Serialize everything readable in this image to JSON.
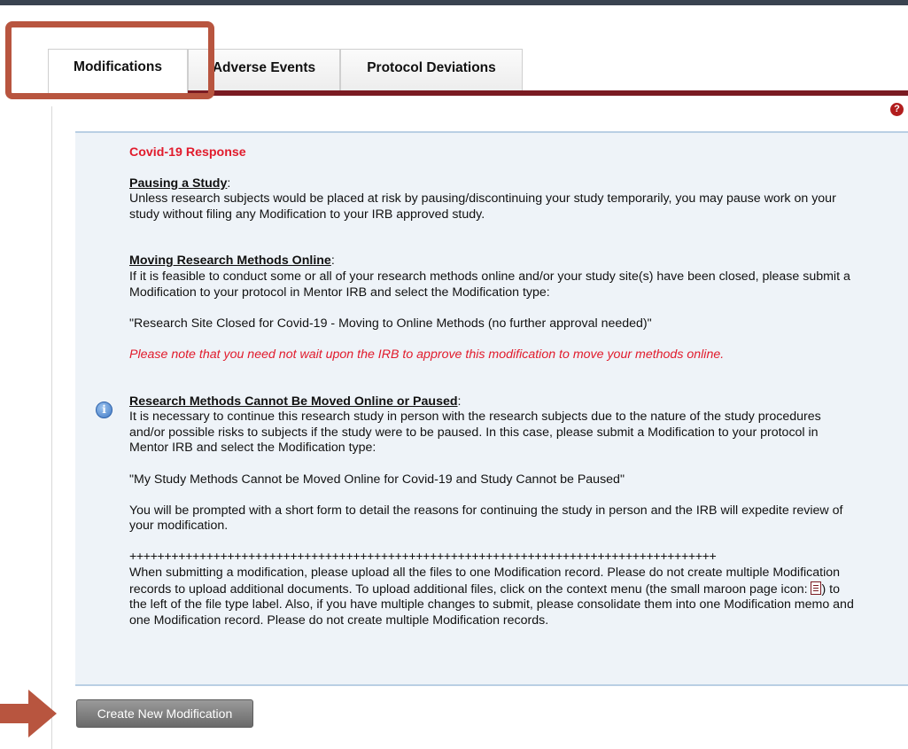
{
  "tabs": [
    {
      "label": "Modifications",
      "active": true
    },
    {
      "label": "Adverse Events",
      "active": false
    },
    {
      "label": "Protocol Deviations",
      "active": false
    }
  ],
  "help_icon": "?",
  "info_icon": "i",
  "notice": {
    "title": "Covid-19 Response",
    "pausing_heading": "Pausing a Study",
    "pausing_text": "Unless research subjects would be placed at risk by pausing/discontinuing your study temporarily, you may pause work on your study without filing any Modification to your IRB approved study.",
    "moving_heading": "Moving Research Methods Online",
    "moving_text": "If it is feasible to conduct some or all of your research methods online and/or your study site(s) have been closed, please submit a Modification to your protocol in Mentor IRB and select the Modification type:",
    "moving_type": "\"Research Site Closed for Covid-19 - Moving to Online Methods (no further approval needed)\"",
    "moving_note": "Please note that you need not wait upon the IRB to approve this modification to move your methods online.",
    "cannot_heading": "Research Methods Cannot Be Moved Online or Paused",
    "cannot_text": "It is necessary to continue this research study in person with the research subjects due to the nature of the study procedures and/or possible risks to subjects if the study were to be paused. In this case, please submit a Modification to your protocol in Mentor IRB and select the Modification type:",
    "cannot_type": "\"My Study Methods Cannot be Moved Online for Covid-19 and Study Cannot be Paused\"",
    "prompted_text": "You will be prompted with a short form to detail the reasons for continuing the study in person and the IRB will expedite review of your modification.",
    "separator": "++++++++++++++++++++++++++++++++++++++++++++++++++++++++++++++++++++++++++++++++++++",
    "upload_text_1": "When submitting a modification, please upload all the files to one Modification record. Please do not create multiple Modification records to upload additional documents. To upload additional files, click on the context menu (the small maroon page icon: ",
    "upload_text_2": ") to the left of the file type label. Also, if you have multiple changes to submit, please consolidate them into one Modification memo and one Modification record. Please do not create multiple Modification records."
  },
  "create_button": "Create New Modification",
  "colors": {
    "maroon": "#7a1b22",
    "alert_red": "#e11b2c",
    "callout_orange": "#b8553f",
    "notice_bg": "#eef3f8"
  },
  "icons": [
    "help-icon",
    "info-icon",
    "page-icon",
    "arrow-icon"
  ]
}
